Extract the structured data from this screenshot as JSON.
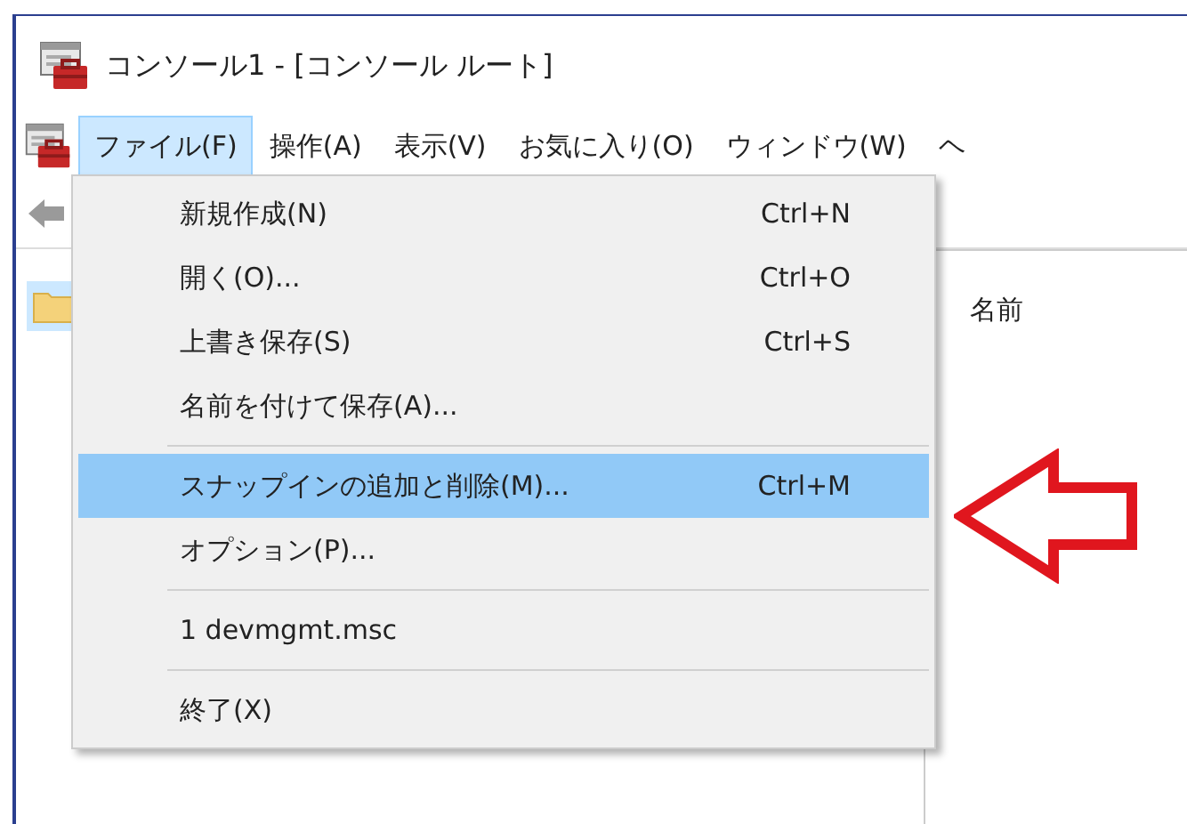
{
  "window": {
    "title": "コンソール1 - [コンソール ルート]"
  },
  "menu_bar": [
    {
      "label": "ファイル(F)",
      "selected": true
    },
    {
      "label": "操作(A)",
      "selected": false
    },
    {
      "label": "表示(V)",
      "selected": false
    },
    {
      "label": "お気に入り(O)",
      "selected": false
    },
    {
      "label": "ウィンドウ(W)",
      "selected": false
    },
    {
      "label": "ヘ",
      "selected": false
    }
  ],
  "file_menu": [
    {
      "kind": "item",
      "label": "新規作成(N)",
      "shortcut": "Ctrl+N",
      "selected": false
    },
    {
      "kind": "item",
      "label": "開く(O)...",
      "shortcut": "Ctrl+O",
      "selected": false
    },
    {
      "kind": "item",
      "label": "上書き保存(S)",
      "shortcut": "Ctrl+S",
      "selected": false
    },
    {
      "kind": "item",
      "label": "名前を付けて保存(A)...",
      "selected": false
    },
    {
      "kind": "separator"
    },
    {
      "kind": "item",
      "label": "スナップインの追加と削除(M)...",
      "shortcut": "Ctrl+M",
      "selected": true
    },
    {
      "kind": "item",
      "label": "オプション(P)...",
      "selected": false
    },
    {
      "kind": "separator"
    },
    {
      "kind": "item",
      "label": "1 devmgmt.msc",
      "selected": false
    },
    {
      "kind": "separator"
    },
    {
      "kind": "item",
      "label": "終了(X)",
      "selected": false
    }
  ],
  "right_pane": {
    "column_header": "名前"
  }
}
